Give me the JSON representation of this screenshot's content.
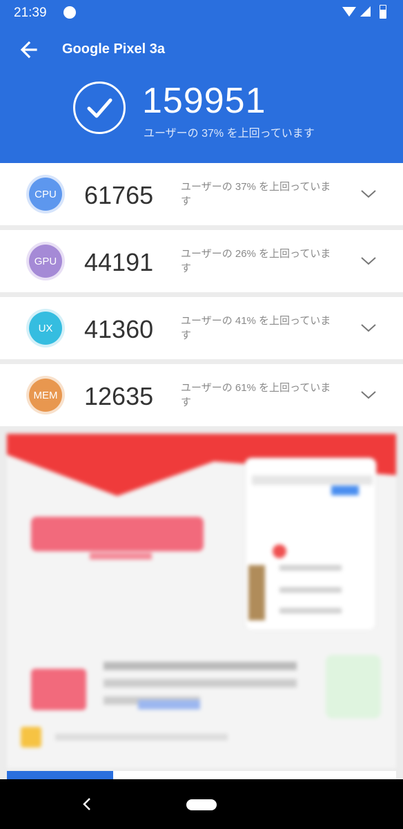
{
  "status_bar": {
    "time": "21:39"
  },
  "header": {
    "device_name": "Google Pixel 3a",
    "total_score": "159951",
    "subtitle": "ユーザーの 37% を上回っています"
  },
  "colors": {
    "header_blue": "#2a6fde",
    "cpu": "#5d97ee",
    "gpu": "#a58ad6",
    "ux": "#35bde0",
    "mem": "#e8974f"
  },
  "scores": [
    {
      "label": "CPU",
      "score": "61765",
      "desc": "ユーザーの 37% を上回っています"
    },
    {
      "label": "GPU",
      "score": "44191",
      "desc": "ユーザーの 26% を上回っています"
    },
    {
      "label": "UX",
      "score": "41360",
      "desc": "ユーザーの 41% を上回っています"
    },
    {
      "label": "MEM",
      "score": "12635",
      "desc": "ユーザーの 61% を上回っています"
    }
  ],
  "icons": [
    "back-arrow-icon",
    "check-icon",
    "chevron-down-icon",
    "nav-back-icon",
    "nav-home-icon"
  ]
}
